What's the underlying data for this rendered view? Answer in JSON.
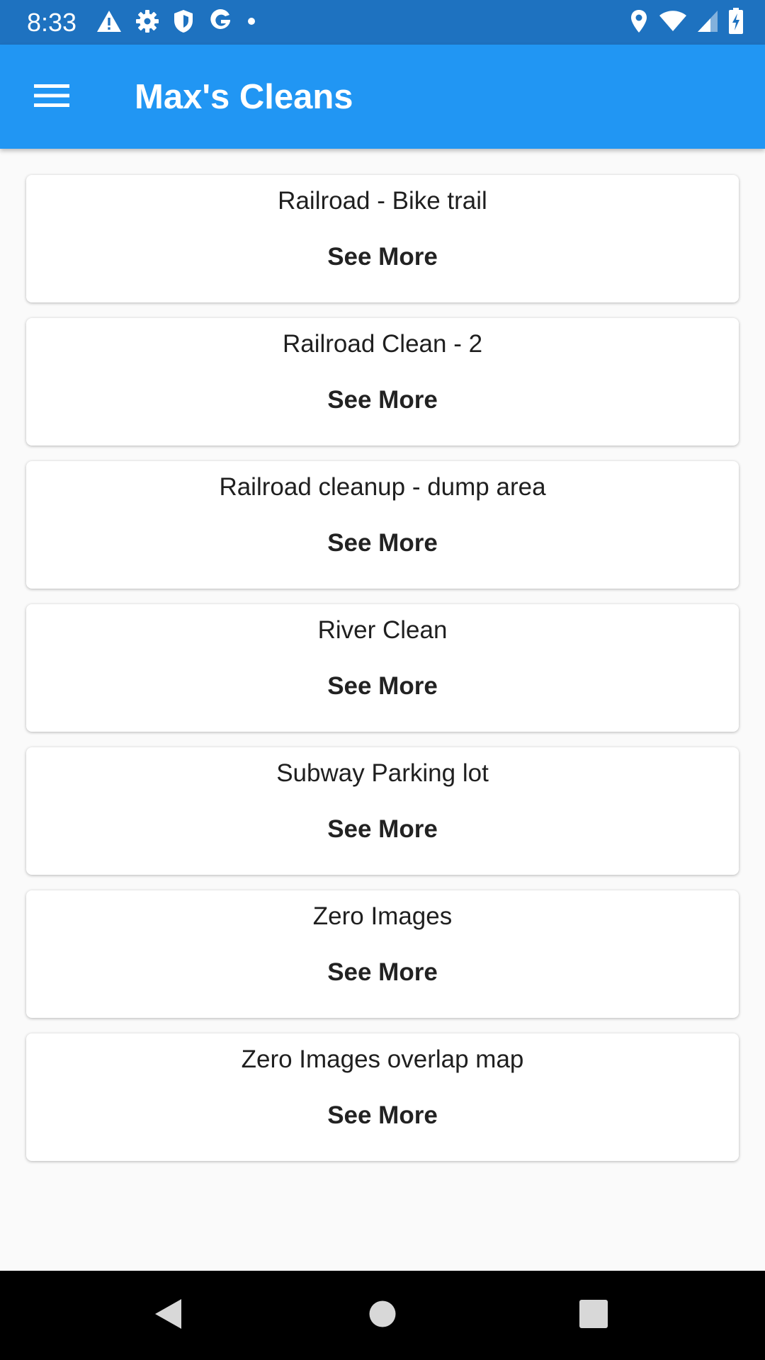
{
  "status_bar": {
    "time": "8:33",
    "left_icons": [
      "warning-icon",
      "settings-gear-icon",
      "shield-icon",
      "google-icon",
      "dot-icon"
    ],
    "right_icons": [
      "location-pin-icon",
      "wifi-icon",
      "cell-signal-icon",
      "battery-charging-icon"
    ]
  },
  "app_bar": {
    "title": "Max's Cleans",
    "menu_icon": "hamburger-menu-icon",
    "background": "#2196f3"
  },
  "cleans": [
    {
      "title": "Railroad - Bike trail",
      "action": "See More"
    },
    {
      "title": "Railroad Clean - 2",
      "action": "See More"
    },
    {
      "title": "Railroad cleanup - dump area",
      "action": "See More"
    },
    {
      "title": "River Clean",
      "action": "See More"
    },
    {
      "title": "Subway Parking lot",
      "action": "See More"
    },
    {
      "title": "Zero Images",
      "action": "See More"
    },
    {
      "title": "Zero Images overlap map",
      "action": "See More"
    }
  ],
  "nav_bar": {
    "buttons": [
      "back-icon",
      "home-icon",
      "recents-icon"
    ]
  }
}
